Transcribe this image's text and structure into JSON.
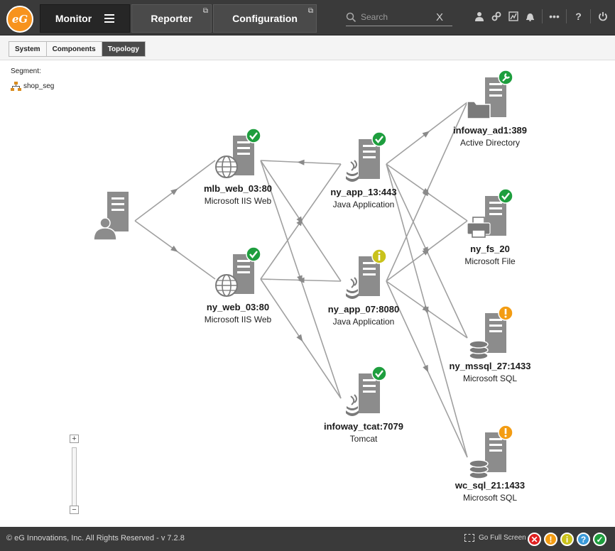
{
  "app": {
    "logo_text": "eG"
  },
  "nav": {
    "monitor": "Monitor",
    "reporter": "Reporter",
    "configuration": "Configuration"
  },
  "search": {
    "placeholder": "Search",
    "clear": "X"
  },
  "toolbar_icons": [
    "user-icon",
    "link-icon",
    "chart-icon",
    "bell-icon",
    "more-icon",
    "help-icon",
    "power-icon"
  ],
  "subtabs": [
    "System",
    "Components",
    "Topology"
  ],
  "active_subtab": "Topology",
  "segment": {
    "label": "Segment:",
    "name": "shop_seg"
  },
  "nodes": [
    {
      "id": "client",
      "name": "",
      "type": "",
      "status": "none",
      "icon": "client-icon"
    },
    {
      "id": "mlb_web",
      "name": "mlb_web_03:80",
      "type": "Microsoft IIS Web",
      "status": "ok",
      "icon": "globe-icon"
    },
    {
      "id": "ny_web",
      "name": "ny_web_03:80",
      "type": "Microsoft IIS Web",
      "status": "ok",
      "icon": "globe-icon"
    },
    {
      "id": "ny_app13",
      "name": "ny_app_13:443",
      "type": "Java Application",
      "status": "ok",
      "icon": "java-icon"
    },
    {
      "id": "ny_app07",
      "name": "ny_app_07:8080",
      "type": "Java Application",
      "status": "info",
      "icon": "java-icon"
    },
    {
      "id": "tcat",
      "name": "infoway_tcat:7079",
      "type": "Tomcat",
      "status": "ok",
      "icon": "java-icon"
    },
    {
      "id": "ad",
      "name": "infoway_ad1:389",
      "type": "Active Directory",
      "status": "maintenance",
      "icon": "folder-icon"
    },
    {
      "id": "fs",
      "name": "ny_fs_20",
      "type": "Microsoft File",
      "status": "ok",
      "icon": "printer-icon"
    },
    {
      "id": "mssql",
      "name": "ny_mssql_27:1433",
      "type": "Microsoft SQL",
      "status": "warning",
      "icon": "database-icon"
    },
    {
      "id": "wcsql",
      "name": "wc_sql_21:1433",
      "type": "Microsoft SQL",
      "status": "warning",
      "icon": "database-icon"
    }
  ],
  "edges": [
    [
      "client",
      "mlb_web"
    ],
    [
      "client",
      "ny_web"
    ],
    [
      "ny_app13",
      "mlb_web"
    ],
    [
      "ny_app07",
      "ny_web"
    ],
    [
      "mlb_web",
      "ny_app07"
    ],
    [
      "ny_web",
      "ny_app13"
    ],
    [
      "mlb_web",
      "tcat"
    ],
    [
      "ny_web",
      "tcat"
    ],
    [
      "ny_app13",
      "ad"
    ],
    [
      "ny_app13",
      "fs"
    ],
    [
      "ny_app13",
      "mssql"
    ],
    [
      "ny_app13",
      "wcsql"
    ],
    [
      "ny_app07",
      "ad"
    ],
    [
      "ny_app07",
      "fs"
    ],
    [
      "ny_app07",
      "mssql"
    ],
    [
      "ny_app07",
      "wcsql"
    ]
  ],
  "zoom": {
    "plus": "+",
    "minus": "−"
  },
  "footer": {
    "copyright": "© eG Innovations, Inc. All Rights Reserved - v 7.2.8",
    "fullscreen": "Go Full Screen"
  },
  "status_legend": [
    {
      "name": "critical",
      "glyph": "✕",
      "color": "#e02020"
    },
    {
      "name": "major",
      "glyph": "!",
      "color": "#f39c12"
    },
    {
      "name": "minor",
      "glyph": "i",
      "color": "#c9c21b"
    },
    {
      "name": "unknown",
      "glyph": "?",
      "color": "#3a9ad9"
    },
    {
      "name": "normal",
      "glyph": "✓",
      "color": "#1e9e3e"
    }
  ],
  "colors": {
    "ok": "#1e9e3e",
    "warning": "#f39c12",
    "info": "#c9c21b",
    "maintenance": "#1e9e3e",
    "server": "#8c8c8c",
    "edge": "#a0a0a0"
  }
}
